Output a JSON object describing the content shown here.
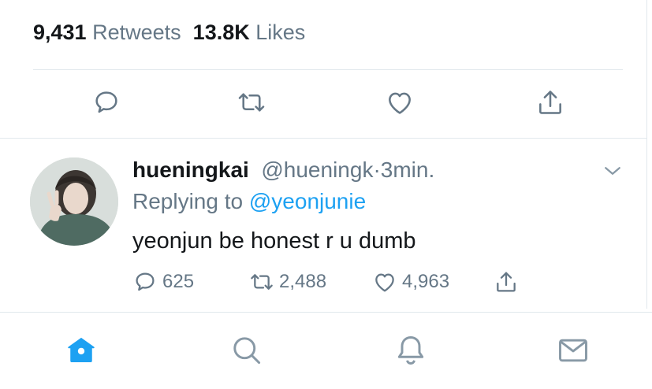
{
  "stats": {
    "retweets_count": "9,431",
    "retweets_label": "Retweets",
    "likes_count": "13.8K",
    "likes_label": "Likes"
  },
  "actions": {
    "icons": [
      "reply-icon",
      "retweet-icon",
      "like-icon",
      "share-icon"
    ]
  },
  "reply": {
    "name": "hueningkai",
    "handle": "@hueningk",
    "dot": "·",
    "time": "3min.",
    "replying_label": "Replying to",
    "replying_to": "@yeonjunie",
    "text": "yeonjun be honest r u dumb",
    "counts": {
      "replies": "625",
      "retweets": "2,488",
      "likes": "4,963"
    }
  },
  "tabbar": {
    "icons": [
      "home-icon",
      "search-icon",
      "notifications-icon",
      "messages-icon"
    ],
    "active": "home-icon"
  },
  "colors": {
    "accent": "#1da1f2",
    "secondary_text": "#657786",
    "icon_gray": "#657786",
    "divider": "#e1e8ed"
  }
}
